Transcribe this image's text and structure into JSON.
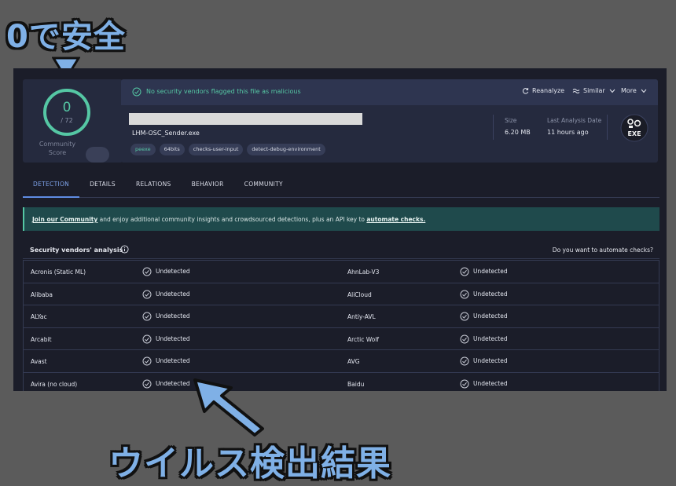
{
  "annotations": {
    "top_text": "0で安全",
    "bottom_text": "ウイルス検出結果"
  },
  "score": {
    "value": "0",
    "total": "/ 72",
    "community_label": "Community Score"
  },
  "header": {
    "status_text": "No security vendors flagged this file as malicious",
    "reanalyze_label": "Reanalyze",
    "similar_label": "Similar",
    "more_label": "More",
    "filename": "LHM-OSC_Sender.exe",
    "tags": [
      "peexe",
      "64bits",
      "checks-user-input",
      "detect-debug-environment"
    ],
    "size_label": "Size",
    "size_value": "6.20 MB",
    "date_label": "Last Analysis Date",
    "date_value": "11 hours ago",
    "file_type": "EXE"
  },
  "tabs": [
    "DETECTION",
    "DETAILS",
    "RELATIONS",
    "BEHAVIOR",
    "COMMUNITY"
  ],
  "banner": {
    "link1": "Join our Community",
    "middle": " and enjoy additional community insights and crowdsourced detections, plus an API key to ",
    "link2": "automate checks."
  },
  "vendors": {
    "title": "Security vendors' analysis",
    "automate_question": "Do you want to automate checks?",
    "rows": [
      {
        "left": "Acronis (Static ML)",
        "left_status": "Undetected",
        "right": "AhnLab-V3",
        "right_status": "Undetected"
      },
      {
        "left": "Alibaba",
        "left_status": "Undetected",
        "right": "AliCloud",
        "right_status": "Undetected"
      },
      {
        "left": "ALYac",
        "left_status": "Undetected",
        "right": "Antiy-AVL",
        "right_status": "Undetected"
      },
      {
        "left": "Arcabit",
        "left_status": "Undetected",
        "right": "Arctic Wolf",
        "right_status": "Undetected"
      },
      {
        "left": "Avast",
        "left_status": "Undetected",
        "right": "AVG",
        "right_status": "Undetected"
      },
      {
        "left": "Avira (no cloud)",
        "left_status": "Undetected",
        "right": "Baidu",
        "right_status": "Undetected"
      }
    ]
  },
  "colors": {
    "accent_green": "#55c7a4",
    "tab_active": "#5f8ce3",
    "annotation_blue": "#7fb0e6"
  }
}
